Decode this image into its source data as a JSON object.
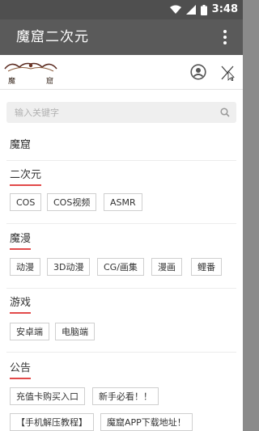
{
  "statusbar": {
    "time": "3:48"
  },
  "appbar": {
    "title": "魔窟二次元"
  },
  "header": {
    "logo_text_left": "魔",
    "logo_text_right": "窟"
  },
  "search": {
    "placeholder": "输入关键字"
  },
  "nav": {
    "home_label": "魔窟",
    "sections": [
      {
        "title": "二次元",
        "tags": [
          "COS",
          "COS视频",
          "ASMR"
        ]
      },
      {
        "title": "魔漫",
        "tags": [
          "动漫",
          "3D动漫",
          "CG/画集",
          "漫画",
          "鲤番"
        ]
      },
      {
        "title": "游戏",
        "tags": [
          "安卓端",
          "电脑端"
        ]
      },
      {
        "title": "公告",
        "tags": [
          "充值卡购买入口",
          "新手必看！！",
          "【手机解压教程】",
          "魔窟APP下载地址！"
        ]
      }
    ]
  },
  "colors": {
    "accent": "#e24a4a",
    "appbar": "#5a5a5a",
    "statusbar": "#4f4f4f"
  }
}
